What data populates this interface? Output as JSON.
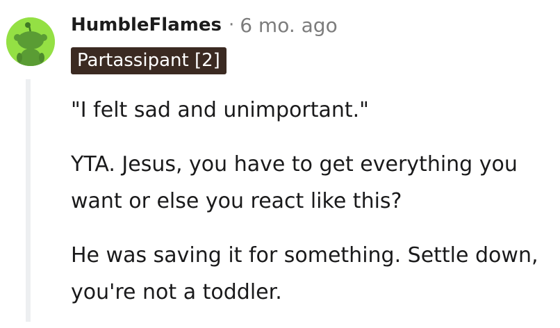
{
  "comment": {
    "username": "HumbleFlames",
    "separator": "·",
    "timestamp": "6 mo. ago",
    "flair": "Partassipant [2]",
    "avatar_icon": "snoo-avatar-icon",
    "avatar_color": "#94e044",
    "paragraphs": [
      "\"I felt sad and unimportant.\"",
      "YTA. Jesus, you have to get everything you want or else you react like this?",
      "He was saving it for something. Settle down, you're not a toddler."
    ]
  }
}
